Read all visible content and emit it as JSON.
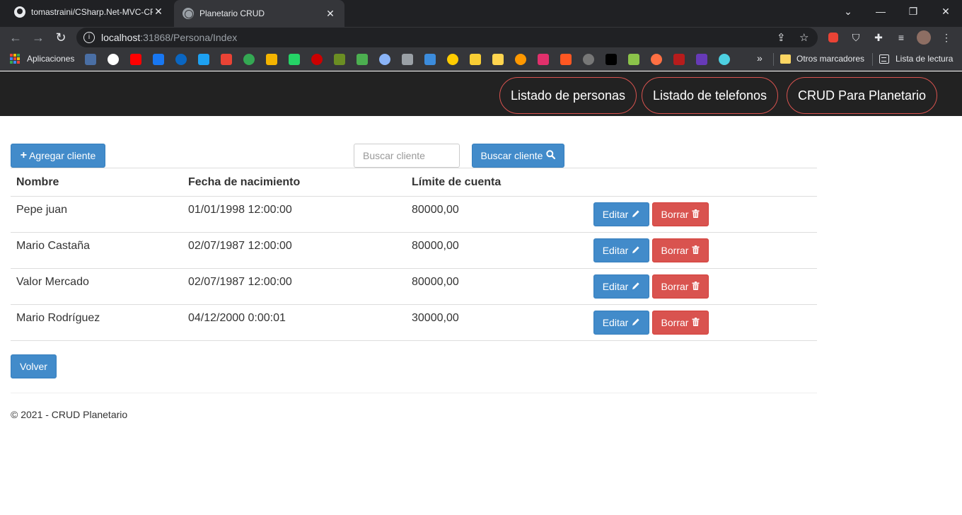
{
  "browser": {
    "tabs": [
      {
        "title": "tomastraini/CSharp.Net-MVC-CR",
        "icon": "github-icon",
        "active": false
      },
      {
        "title": "Planetario CRUD",
        "icon": "globe-icon",
        "active": true
      }
    ],
    "url_host": "localhost",
    "url_rest": ":31868/Persona/Index",
    "bookmarks": {
      "apps_label": "Aplicaciones",
      "more_symbol": "»",
      "other_label": "Otros marcadores",
      "reading_label": "Lista de lectura",
      "icon_colors": [
        "#4a6fa5",
        "#ffffff",
        "#ff0000",
        "#1877f2",
        "#0a66c2",
        "#1da1f2",
        "#ea4335",
        "#34a853",
        "#f4b400",
        "#25d366",
        "#cc0000",
        "#6b8e23",
        "#4caf50",
        "#8ab4f8",
        "#9aa0a6",
        "#3c8cdc",
        "#ffcc00",
        "#f9ce34",
        "#ffd54f",
        "#ff9800",
        "#e1306c",
        "#ff5722",
        "#777777",
        "#000000",
        "#8bc34a",
        "#ff7043",
        "#b71c1c",
        "#673ab7",
        "#4dd0e1"
      ]
    }
  },
  "nav": {
    "items": [
      {
        "label": "Listado de personas"
      },
      {
        "label": "Listado de telefonos"
      },
      {
        "label": "CRUD Para Planetario"
      }
    ],
    "accent_color": "#d9534f"
  },
  "actions": {
    "add_label": "Agregar cliente",
    "search_placeholder": "Buscar cliente",
    "search_value": "",
    "search_button_label": "Buscar cliente"
  },
  "table": {
    "headers": [
      "Nombre",
      "Fecha de nacimiento",
      "Límite de cuenta"
    ],
    "edit_label": "Editar",
    "delete_label": "Borrar",
    "rows": [
      {
        "nombre": "Pepe juan",
        "fecha": "01/01/1998 12:00:00",
        "limite": "80000,00"
      },
      {
        "nombre": "Mario Castaña",
        "fecha": "02/07/1987 12:00:00",
        "limite": "80000,00"
      },
      {
        "nombre": "Valor Mercado",
        "fecha": "02/07/1987 12:00:00",
        "limite": "80000,00"
      },
      {
        "nombre": "Mario Rodríguez",
        "fecha": "04/12/2000 0:00:01",
        "limite": "30000,00"
      }
    ]
  },
  "back_label": "Volver",
  "footer": {
    "text": "© 2021 - CRUD Planetario"
  },
  "colors": {
    "primary": "#428bca",
    "danger": "#d9534f",
    "navbar": "#222222"
  }
}
